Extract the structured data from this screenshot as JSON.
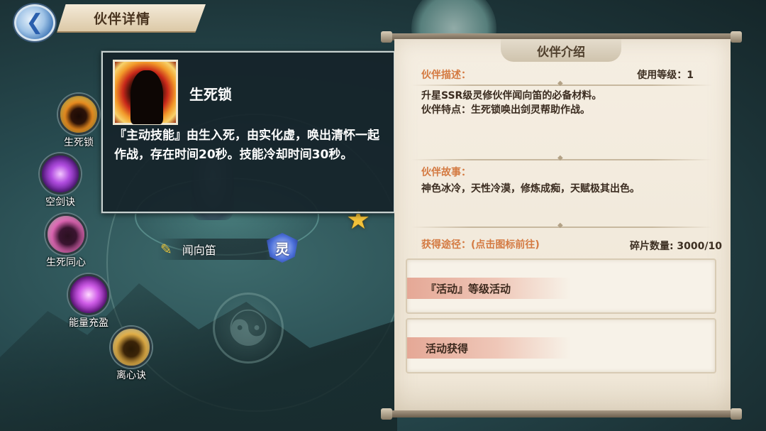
{
  "header": {
    "title": "伙伴详情",
    "back_glyph": "❮"
  },
  "skills": [
    {
      "label": "生死锁"
    },
    {
      "label": "空剑诀"
    },
    {
      "label": "生死同心"
    },
    {
      "label": "能量充盈"
    },
    {
      "label": "离心诀"
    }
  ],
  "partner": {
    "name": "闻向笛",
    "badge": "灵",
    "flute_glyph": "✎"
  },
  "tooltip": {
    "title": "生死锁",
    "description": "『主动技能』由生入死，由实化虚，唤出清怀一起作战，存在时间20秒。技能冷却时间30秒。"
  },
  "panel": {
    "header": "伙伴介绍",
    "desc_label": "伙伴描述：",
    "level_text": "使用等级：1",
    "desc_line1": "升星SSR级灵修伙伴闻向笛的必备材料。",
    "desc_line2": "伙伴特点：生死锁唤出剑灵帮助作战。",
    "story_label": "伙伴故事：",
    "story_text": "神色冰冷，天性冷漠，修炼成痴，天赋极其出色。",
    "source_label": "获得途径：(点击图标前往)",
    "fragment_text": "碎片数量: 3000/10",
    "sources": [
      {
        "label": "『活动』等级活动"
      },
      {
        "label": "活动获得"
      }
    ]
  },
  "colors": {
    "accent_orange": "#d47a42",
    "star": "#f2c23a",
    "panel_bg": "#f5eee2"
  }
}
